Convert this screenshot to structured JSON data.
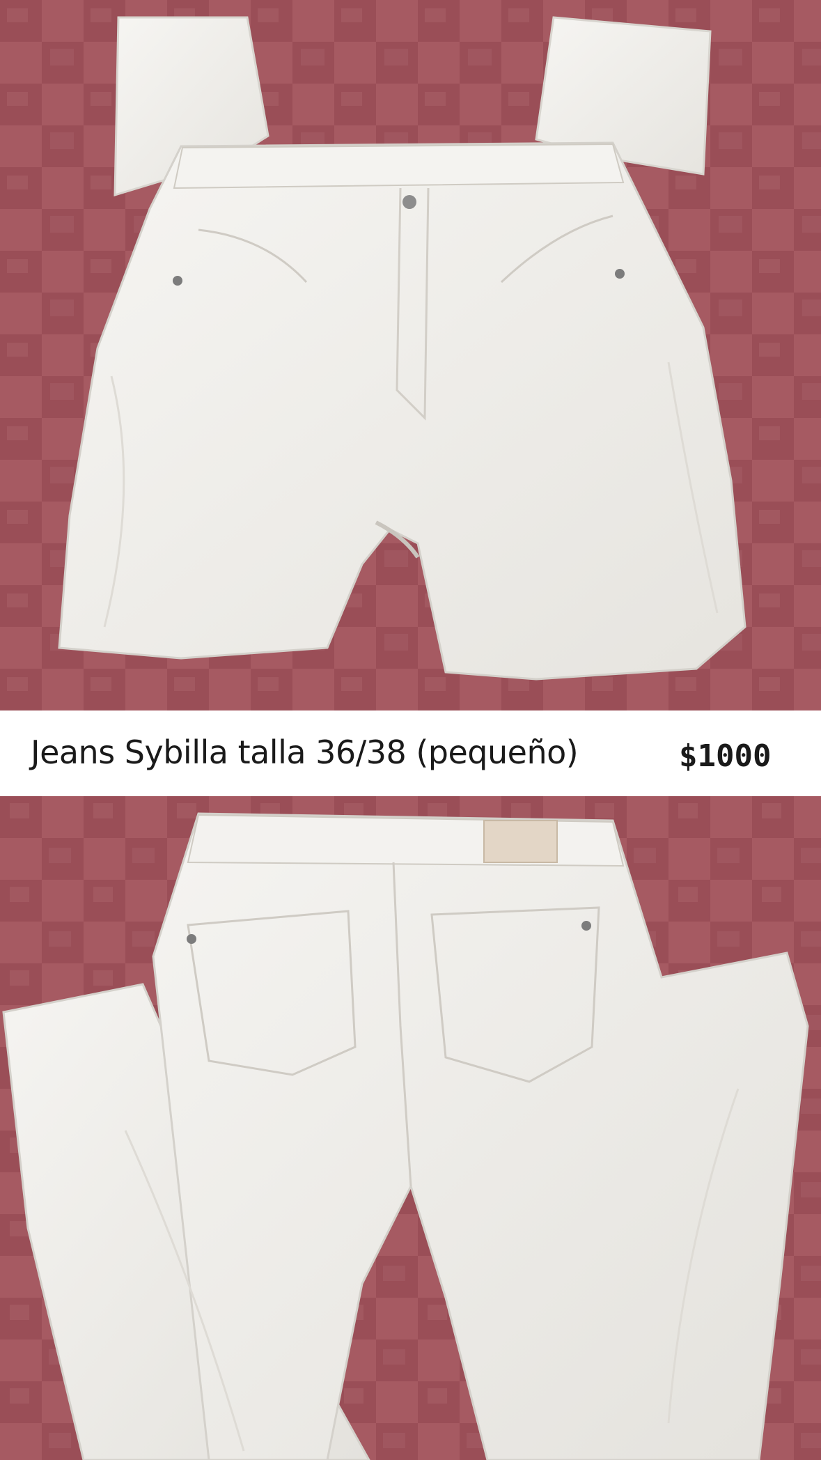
{
  "listing": {
    "title": "Jeans Sybilla talla 36/38 (pequeño)",
    "price": "$1000"
  },
  "photos": {
    "front": {
      "subject": "white-jeans-front"
    },
    "back": {
      "subject": "white-jeans-back"
    }
  },
  "colors": {
    "background": "#a65a62",
    "fabric": "#f2f1ee",
    "caption_text": "#1a1a1a"
  }
}
